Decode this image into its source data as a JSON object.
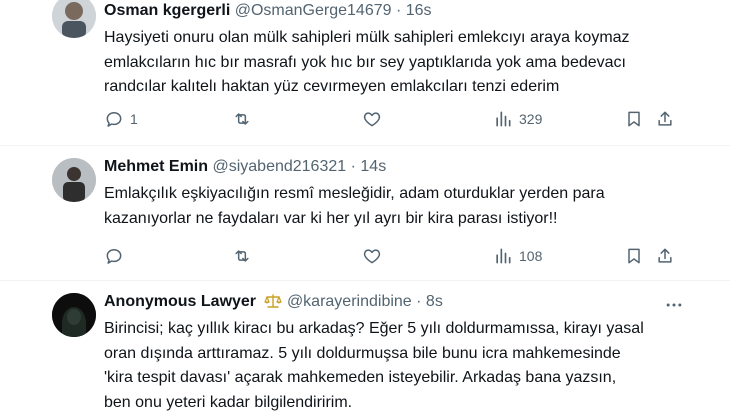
{
  "tweets": [
    {
      "author": "Osman kgergerli",
      "handle": "@OsmanGerge14679",
      "sep": "·",
      "time": "16s",
      "lines": [
        "Haysiyeti onuru olan mülk sahipleri mülk sahipleri emlekcıyı araya koymaz",
        "emlakcıların hıc bır masrafı yok hıc bır sey yaptıklarıda yok ama bedevacı",
        "randcılar kalıtelı haktan yüz cevırmeyen emlakcıları tenzi ederim"
      ],
      "replies": "1",
      "retweets": "",
      "likes": "",
      "views": "329"
    },
    {
      "author": "Mehmet Emin",
      "handle": "@siyabend216321",
      "sep": "·",
      "time": "14s",
      "lines": [
        "Emlakçılık eşkiyacılığın resmî mesleğidir, adam oturduklar yerden para",
        "kazanıyorlar ne faydaları var ki her yıl ayrı bir kira parası istiyor!!"
      ],
      "replies": "",
      "retweets": "",
      "likes": "",
      "views": "108"
    },
    {
      "author": "Anonymous Lawyer",
      "badge_icon": "scales-icon",
      "handle": "@karayerindibine",
      "sep": "·",
      "time": "8s",
      "lines": [
        "Birincisi; kaç yıllık kiracı bu arkadaş? Eğer 5 yılı doldurmamıssa, kirayı yasal",
        "oran dışında arttıramaz. 5 yılı doldurmuşsa bile bunu icra mahkemesinde",
        "'kira tespit davası' açarak mahkemeden isteyebilir. Arkadaş bana yazsın,",
        "ben onu yeteri kadar bilgilendiririm."
      ]
    }
  ],
  "colors": {
    "text": "#0f1419",
    "muted": "#536471",
    "border": "#eff3f4",
    "badge": "#c9a227"
  }
}
